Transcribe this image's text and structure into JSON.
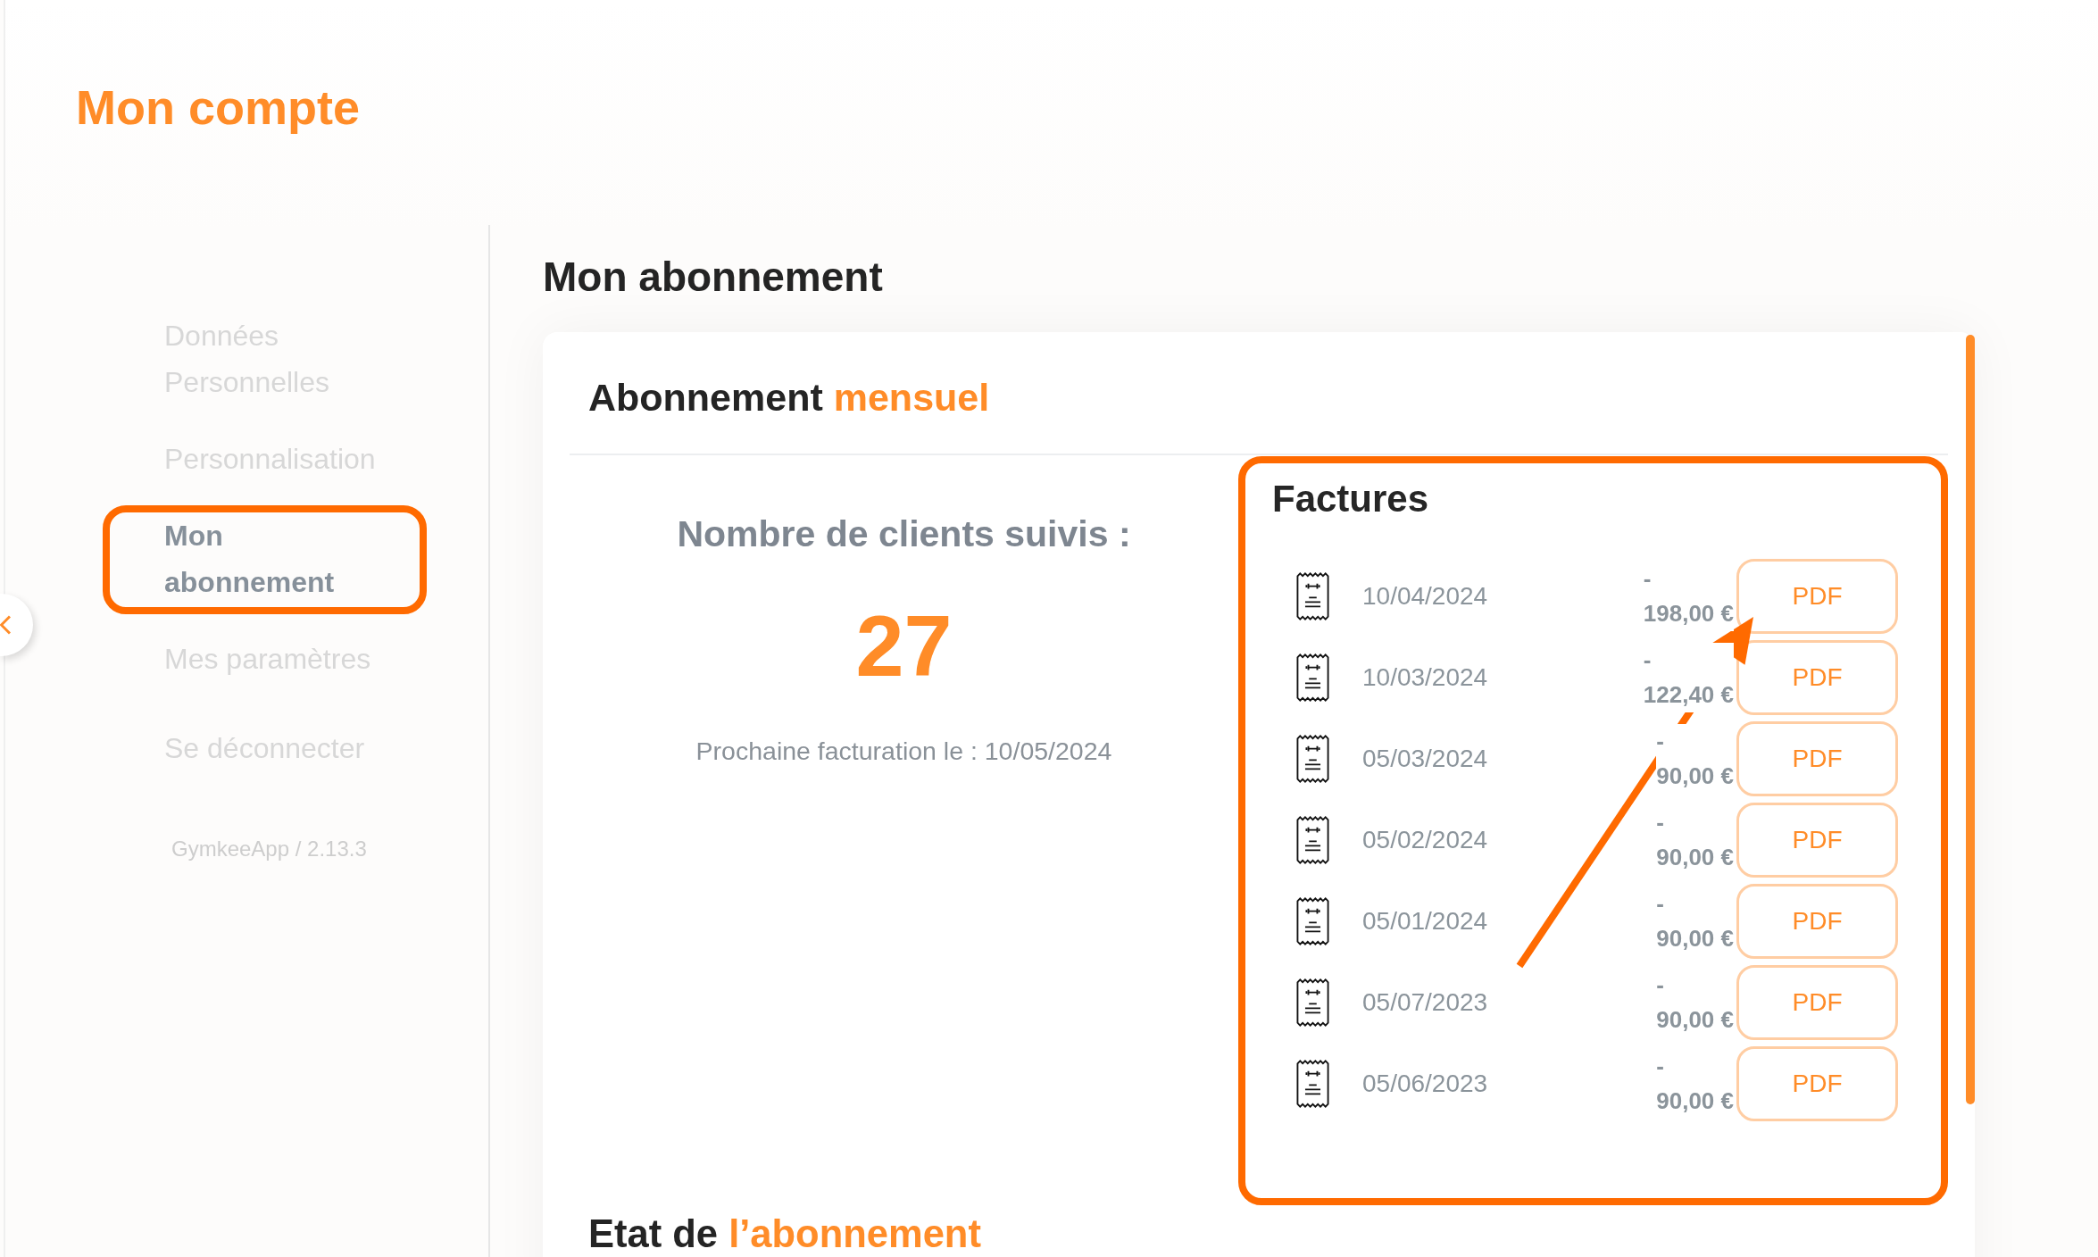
{
  "page": {
    "title": "Mon compte"
  },
  "sidebar": {
    "items": [
      {
        "label": "Données Personnelles",
        "selected": false,
        "highlighted": false
      },
      {
        "label": "Personnalisation",
        "selected": false,
        "highlighted": false
      },
      {
        "label": "Mon abonnement",
        "selected": true,
        "highlighted": true
      },
      {
        "label": "Mes paramètres",
        "selected": false,
        "highlighted": false
      },
      {
        "label": "Se déconnecter",
        "selected": false,
        "highlighted": false
      }
    ],
    "version": "GymkeeApp / 2.13.3"
  },
  "main": {
    "heading": "Mon abonnement",
    "card": {
      "title": "Abonnement",
      "title_accent": "mensuel",
      "clients_label": "Nombre de clients suivis :",
      "clients_count": "27",
      "next_billing": "Prochaine facturation le : 10/05/2024",
      "invoices": {
        "title": "Factures",
        "highlighted": true,
        "items": [
          {
            "date": "10/04/2024",
            "amount": "- 198,00 €",
            "button": "PDF",
            "pointer": true
          },
          {
            "date": "10/03/2024",
            "amount": "- 122,40 €",
            "button": "PDF",
            "pointer": false
          },
          {
            "date": "05/03/2024",
            "amount": "- 90,00 €",
            "button": "PDF",
            "pointer": false
          },
          {
            "date": "05/02/2024",
            "amount": "- 90,00 €",
            "button": "PDF",
            "pointer": false
          },
          {
            "date": "05/01/2024",
            "amount": "- 90,00 €",
            "button": "PDF",
            "pointer": false
          },
          {
            "date": "05/07/2023",
            "amount": "- 90,00 €",
            "button": "PDF",
            "pointer": false
          },
          {
            "date": "05/06/2023",
            "amount": "- 90,00 €",
            "button": "PDF",
            "pointer": false
          }
        ]
      },
      "status_title": "Etat de",
      "status_title_accent": "l’abonnement"
    }
  }
}
